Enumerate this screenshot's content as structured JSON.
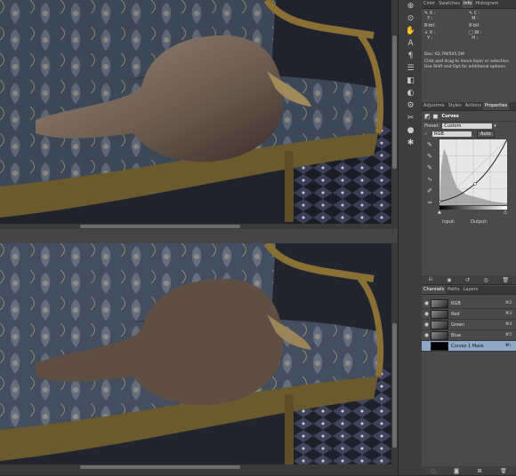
{
  "tools": [
    "⊕",
    "⊙",
    "✋",
    "A",
    "¶",
    "☰",
    "◧",
    "◐",
    "⚙",
    "✂",
    "●",
    "✱"
  ],
  "info": {
    "tabs": [
      "Color",
      "Swatches",
      "Info",
      "Histogram"
    ],
    "active_tab": "Info",
    "row1": {
      "left_x": "X :",
      "left_y": "Y :",
      "right_x": "C :",
      "right_y": "M :"
    },
    "bit_left": "8-bit",
    "bit_right": "8-bit",
    "row2": {
      "left_x": "X :",
      "left_y": "Y :",
      "right_w": "W :",
      "right_h": "H :"
    },
    "doc": "Doc: 62,7M/505,5M",
    "hint": "Click and drag to move layer or selection. Use Shift and Opt for additional options."
  },
  "properties": {
    "tabs": [
      "Adjustme",
      "Styles",
      "Actions",
      "Properties"
    ],
    "active_tab": "Properties",
    "title": "Curves",
    "preset_label": "Preset:",
    "preset_value": "Custom",
    "channel_value": "RGB",
    "auto_label": "Auto",
    "input_label": "Input:",
    "output_label": "Output:"
  },
  "layers": {
    "tabs": [
      "Channels",
      "Paths",
      "Layers"
    ],
    "active_tab": "Channels",
    "rows": [
      {
        "name": "RGB",
        "shortcut": "⌘2"
      },
      {
        "name": "Red",
        "shortcut": "⌘3"
      },
      {
        "name": "Green",
        "shortcut": "⌘4"
      },
      {
        "name": "Blue",
        "shortcut": "⌘5"
      },
      {
        "name": "Curves 1 Mask",
        "shortcut": "⌘\\"
      }
    ]
  },
  "colors": {
    "selection": "#8fa8c8",
    "panel": "#4a4a4a"
  }
}
